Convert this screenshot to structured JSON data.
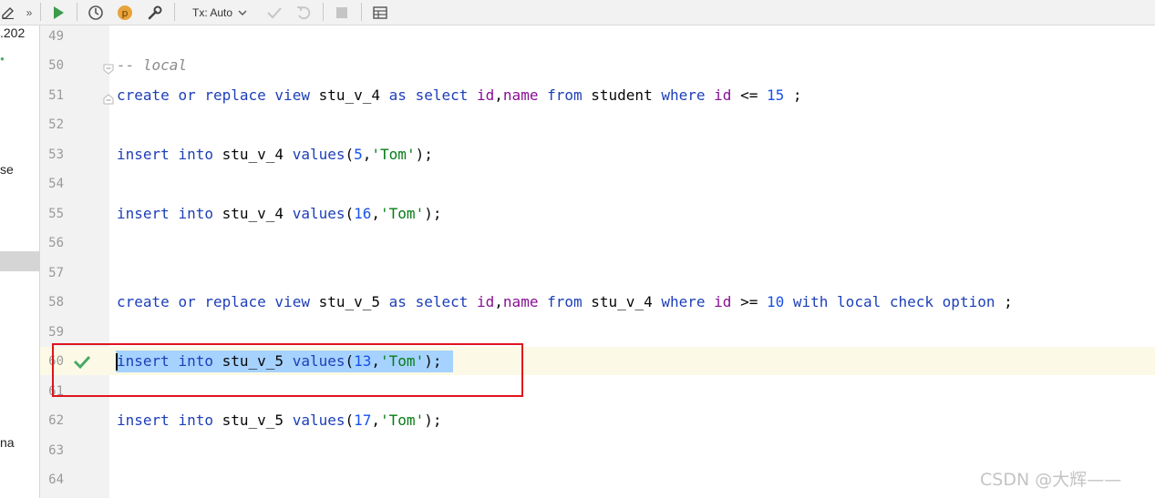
{
  "toolbar": {
    "tx_mode_label": "Tx: Auto",
    "run_icon": "play-icon",
    "history_icon": "clock-icon",
    "profile_icon": "p-badge-icon",
    "settings_icon": "wrench-icon",
    "commit_icon": "checkmark-icon",
    "rollback_icon": "undo-icon",
    "stop_icon": "stop-icon",
    "table_icon": "table-icon",
    "accent_green": "#3c9b4c",
    "badge_color": "#e8a33a"
  },
  "left_panel": {
    "item1": ".202",
    "item2": "se",
    "item3": "na"
  },
  "gutter": {
    "line_numbers": [
      "49",
      "50",
      "51",
      "52",
      "53",
      "54",
      "55",
      "56",
      "57",
      "58",
      "59",
      "60",
      "61",
      "62",
      "63",
      "64"
    ],
    "executed_icon": "checkmark-icon"
  },
  "editor": {
    "line50": {
      "comment": "-- local"
    },
    "line51": {
      "t1": "create",
      "t2": "or",
      "t3": "replace",
      "t4": "view",
      "t5": "stu_v_4",
      "t6": "as",
      "t7": "select",
      "t8": "id",
      "t9": ",",
      "t10": "name",
      "t11": "from",
      "t12": "student",
      "t13": "where",
      "t14": "id",
      "t15": "<=",
      "t16": "15",
      "t17": ";"
    },
    "line53": {
      "t1": "insert",
      "t2": "into",
      "t3": "stu_v_4",
      "t4": "values",
      "t5": "(",
      "t6": "5",
      "t7": ",",
      "t8": "'Tom'",
      "t9": ");"
    },
    "line55": {
      "t1": "insert",
      "t2": "into",
      "t3": "stu_v_4",
      "t4": "values",
      "t5": "(",
      "t6": "16",
      "t7": ",",
      "t8": "'Tom'",
      "t9": ");"
    },
    "line58": {
      "t1": "create",
      "t2": "or",
      "t3": "replace",
      "t4": "view",
      "t5": "stu_v_5",
      "t6": "as",
      "t7": "select",
      "t8": "id",
      "t9": ",",
      "t10": "name",
      "t11": "from",
      "t12": "stu_v_4",
      "t13": "where",
      "t14": "id",
      "t15": ">=",
      "t16": "10",
      "t17": "with",
      "t18": "local",
      "t19": "check",
      "t20": "option",
      "t21": ";"
    },
    "line60": {
      "t1": "insert",
      "t2": "into",
      "t3": "stu_v_5",
      "t4": "values",
      "t5": "(",
      "t6": "13",
      "t7": ",",
      "t8": "'Tom'",
      "t9": ");"
    },
    "line62": {
      "t1": "insert",
      "t2": "into",
      "t3": "stu_v_5",
      "t4": "values",
      "t5": "(",
      "t6": "17",
      "t7": ",",
      "t8": "'Tom'",
      "t9": ");"
    }
  },
  "colors": {
    "keyword": "#1d3fb8",
    "identifier_purple": "#871094",
    "string": "#067d17",
    "number": "#1750eb",
    "selection": "#a6d2ff",
    "annotation_box": "#e0141e"
  },
  "watermark": "CSDN @大辉——"
}
